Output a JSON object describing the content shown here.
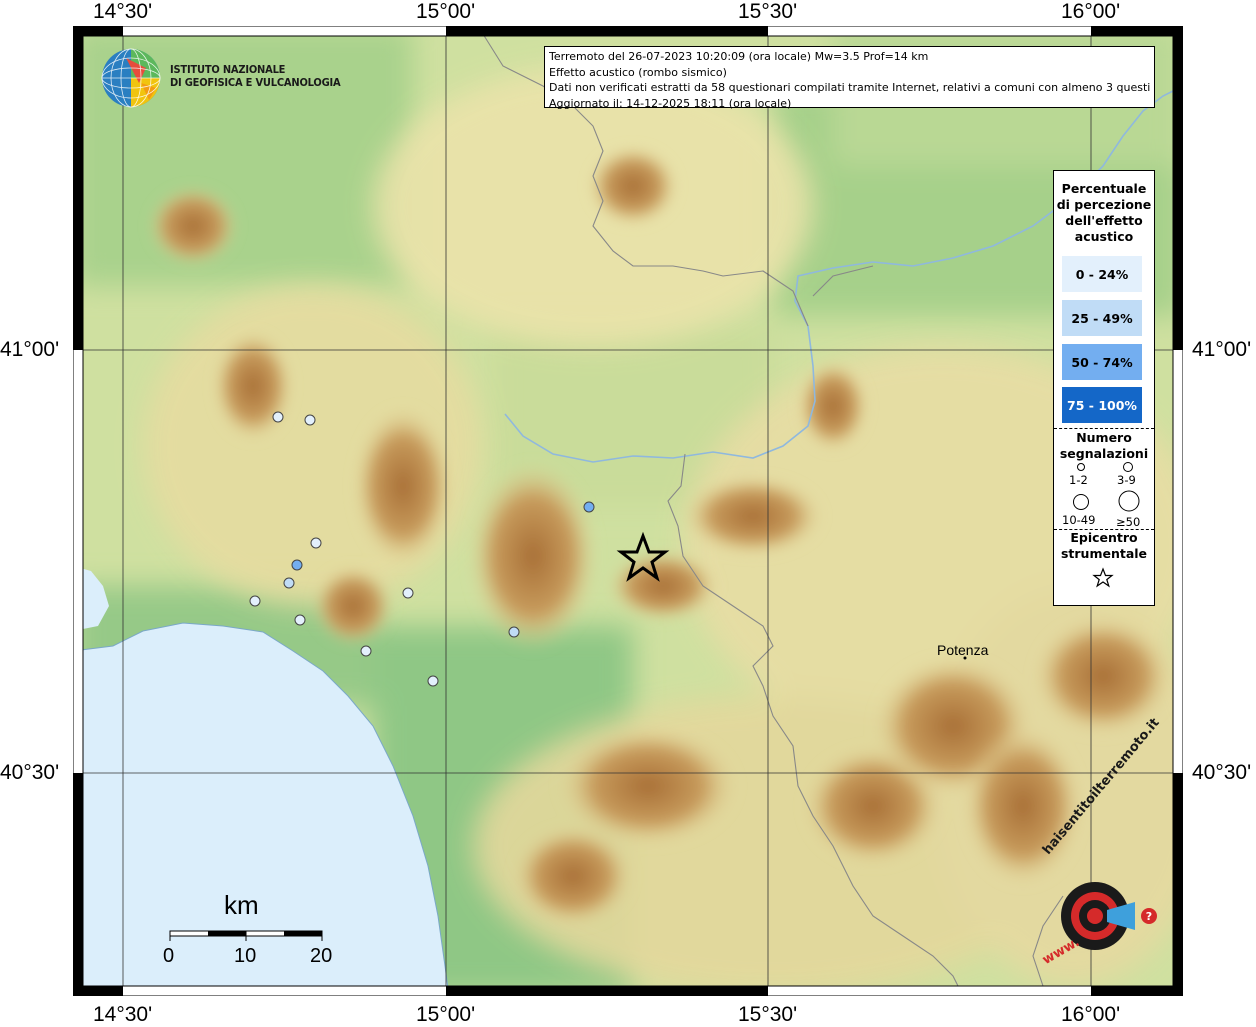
{
  "axis": {
    "top_labels": [
      "14°30'",
      "15°00'",
      "15°30'",
      "16°00'"
    ],
    "bottom_labels": [
      "14°30'",
      "15°00'",
      "15°30'",
      "16°00'"
    ],
    "left_labels": [
      "41°00'",
      "40°30'"
    ],
    "right_labels": [
      "41°00'",
      "40°30'"
    ]
  },
  "logo": {
    "line1": "ISTITUTO NAZIONALE",
    "line2": "DI GEOFISICA E VULCANOLOGIA"
  },
  "info": {
    "line1": "Terremoto del 26-07-2023 10:20:09 (ora locale) Mw=3.5 Prof=14 km",
    "line2": "Effetto acustico (rombo sismico)",
    "line3": "Dati non verificati estratti da 58 questionari compilati tramite Internet, relativi a comuni con almeno 3 questionari.",
    "line4": "Aggiornato il: 14-12-2025 18:11 (ora locale)"
  },
  "legend": {
    "title": "Percentuale di percezione dell'effetto acustico",
    "title_lines": [
      "Percentuale",
      "di percezione",
      "dell'effetto",
      "acustico"
    ],
    "classes": [
      {
        "label": "0 - 24%",
        "color": "#e3f0fc",
        "text_color": "#000000"
      },
      {
        "label": "25 - 49%",
        "color": "#c0dcf6",
        "text_color": "#000000"
      },
      {
        "label": "50 - 74%",
        "color": "#73aef0",
        "text_color": "#000000"
      },
      {
        "label": "75 - 100%",
        "color": "#1467c8",
        "text_color": "#ffffff"
      }
    ],
    "count_title_lines": [
      "Numero",
      "segnalazioni"
    ],
    "counts": [
      "1-2",
      "3-9",
      "10-49",
      "≥50"
    ],
    "epicenter_title_lines": [
      "Epicentro",
      "strumentale"
    ]
  },
  "places": [
    {
      "name": "Potenza"
    }
  ],
  "points": [
    {
      "color": "#e3f0fc"
    },
    {
      "color": "#e3f0fc"
    },
    {
      "color": "#73aef0"
    },
    {
      "color": "#e3f0fc"
    },
    {
      "color": "#73aef0"
    },
    {
      "color": "#c0dcf6"
    },
    {
      "color": "#e3f0fc"
    },
    {
      "color": "#e3f0fc"
    },
    {
      "color": "#e3f0fc"
    },
    {
      "color": "#e3f0fc"
    },
    {
      "color": "#c0dcf6"
    },
    {
      "color": "#e3f0fc"
    }
  ],
  "scale_bar": {
    "unit": "km",
    "ticks": [
      "0",
      "10",
      "20"
    ]
  },
  "watermark": {
    "text_top": "haisentitoilterremoto.it",
    "text_bottom": "www."
  },
  "colors": {
    "sea": "#dbeefb",
    "lowland": "#8fc785",
    "hill": "#e8e0a6",
    "mountain": "#b8834a"
  }
}
